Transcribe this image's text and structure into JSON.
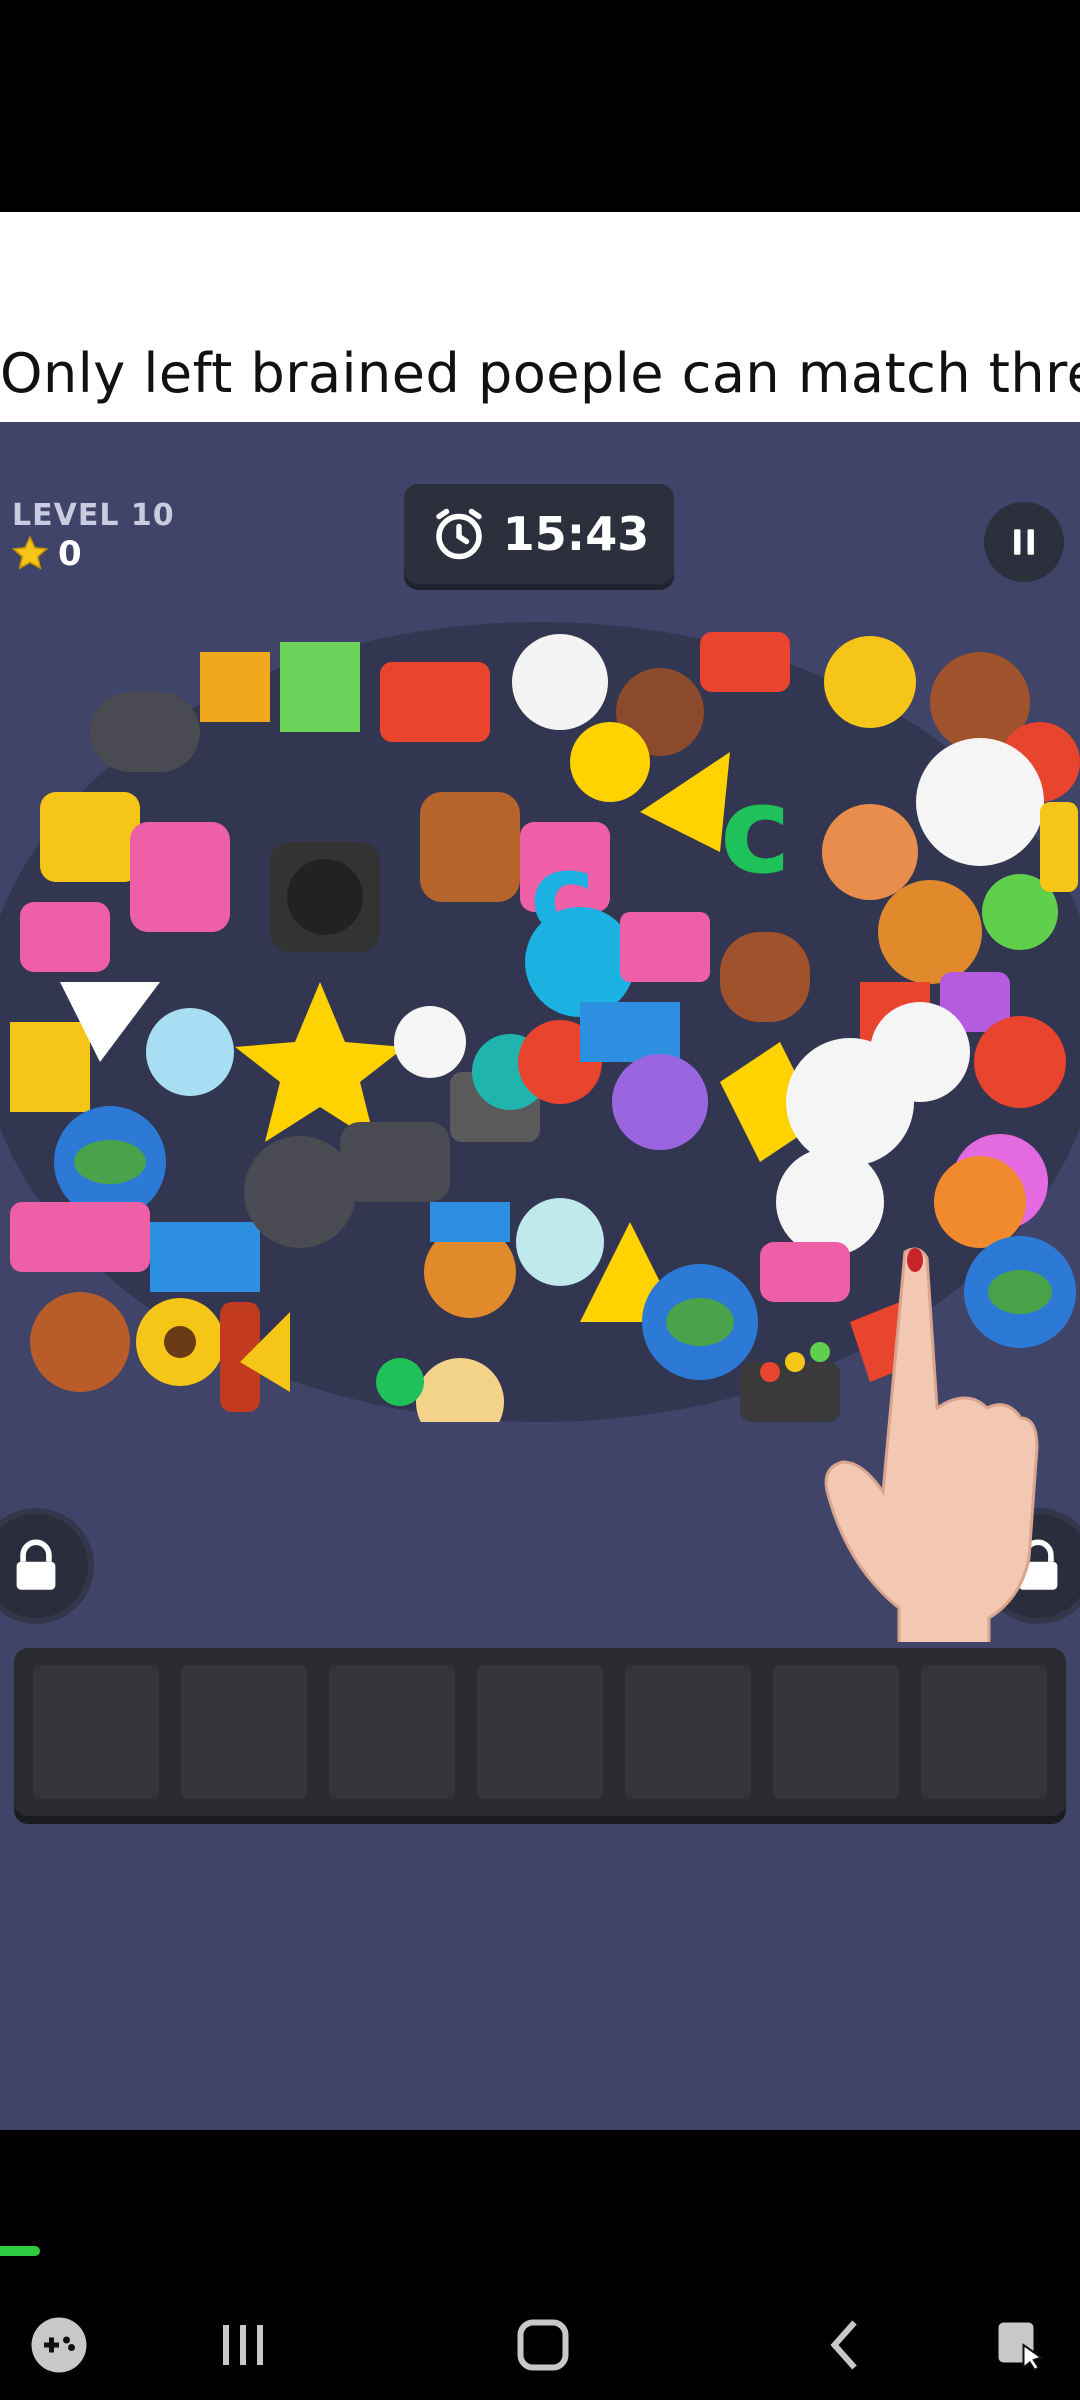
{
  "caption": "Only left brained poeple can match three",
  "hud": {
    "level_label": "LEVEL 10",
    "stars": "0",
    "timer": "15:43"
  },
  "icons": {
    "star": "star-icon",
    "timer": "alarm-clock-icon",
    "pause": "pause-icon",
    "lock": "lock-icon",
    "game_launcher": "gamepad-icon",
    "recents": "recents-icon",
    "home": "home-icon",
    "back": "back-icon",
    "screenshot_toggle": "screenshot-icon"
  },
  "tray_slots": 7,
  "colors": {
    "game_bg": "#3f4468",
    "panel": "#2c2f3c",
    "progress": "#2ecc40"
  }
}
